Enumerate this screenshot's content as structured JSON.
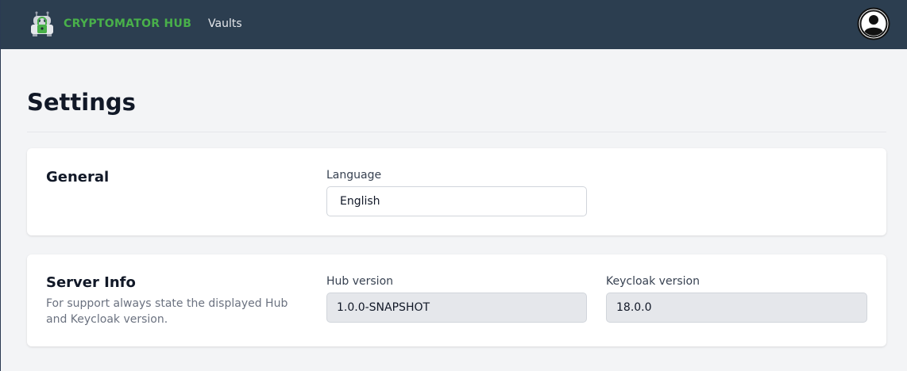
{
  "navbar": {
    "brand": "CRYPTOMATOR HUB",
    "links": [
      {
        "label": "Vaults"
      }
    ],
    "logo_icon": "cryptomator-robot-icon",
    "profile_icon": "user-circle-icon",
    "colors": {
      "background": "#2c3e50",
      "brand": "#49b04a"
    }
  },
  "page": {
    "title": "Settings"
  },
  "general": {
    "title": "General",
    "language_label": "Language",
    "language_value": "English"
  },
  "server_info": {
    "title": "Server Info",
    "description": "For support always state the displayed Hub and Keycloak version.",
    "hub_version_label": "Hub version",
    "hub_version_value": "1.0.0-SNAPSHOT",
    "keycloak_version_label": "Keycloak version",
    "keycloak_version_value": "18.0.0"
  }
}
